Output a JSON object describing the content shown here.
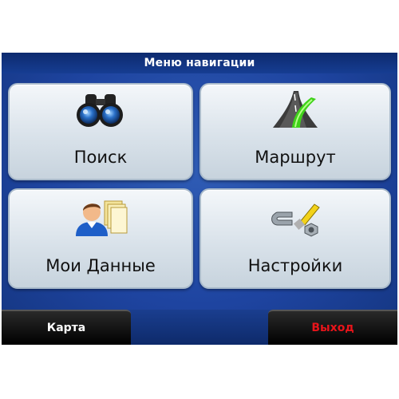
{
  "header": {
    "title": "Меню навигации"
  },
  "tiles": [
    {
      "label": "Поиск",
      "icon": "binoculars-icon"
    },
    {
      "label": "Маршрут",
      "icon": "road-route-icon"
    },
    {
      "label": "Мои Данные",
      "icon": "user-documents-icon"
    },
    {
      "label": "Настройки",
      "icon": "wrench-nut-icon"
    }
  ],
  "bottom": {
    "left_label": "Карта",
    "right_label": "Выход"
  },
  "colors": {
    "background": "#1e44a0",
    "tile": "#dde6ee",
    "exit": "#e8141a",
    "route_highlight": "#3fd21a"
  }
}
